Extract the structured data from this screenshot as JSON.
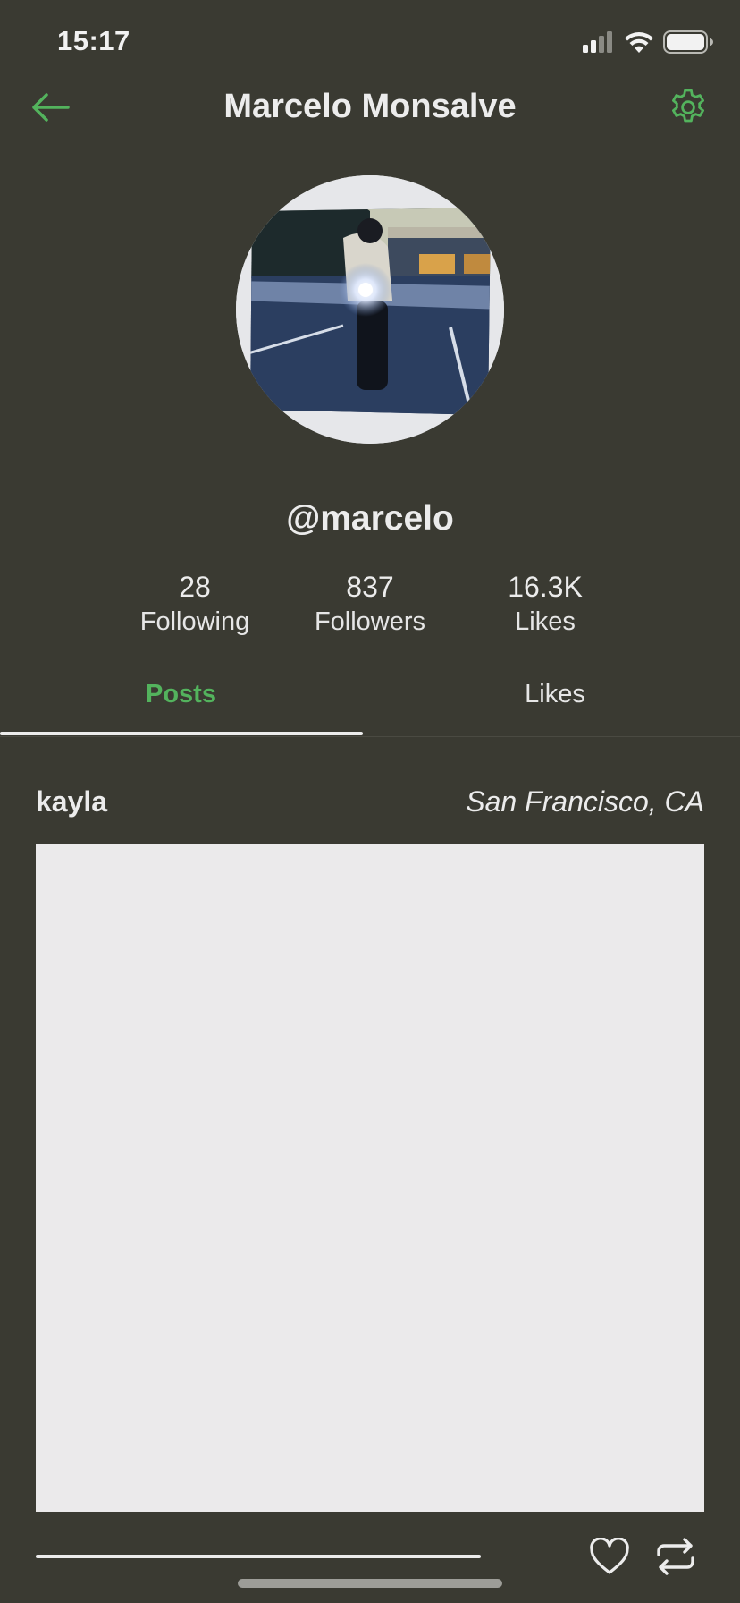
{
  "status_bar": {
    "time": "15:17",
    "icons": [
      "signal-icon",
      "wifi-icon",
      "battery-icon"
    ]
  },
  "header": {
    "title": "Marcelo Monsalve",
    "back_icon": "arrow-left-icon",
    "settings_icon": "gear-icon"
  },
  "profile": {
    "username": "@marcelo",
    "stats": [
      {
        "value": "28",
        "label": "Following"
      },
      {
        "value": "837",
        "label": "Followers"
      },
      {
        "value": "16.3K",
        "label": "Likes"
      }
    ]
  },
  "tabs": [
    {
      "label": "Posts",
      "active": true
    },
    {
      "label": "Likes",
      "active": false
    }
  ],
  "post": {
    "user": "kayla",
    "location": "San Francisco, CA",
    "actions": [
      "heart-icon",
      "repost-icon"
    ]
  },
  "colors": {
    "background": "#3a3a32",
    "accent": "#53b35d",
    "text": "#ececec",
    "image_placeholder": "#ebeaeb"
  }
}
